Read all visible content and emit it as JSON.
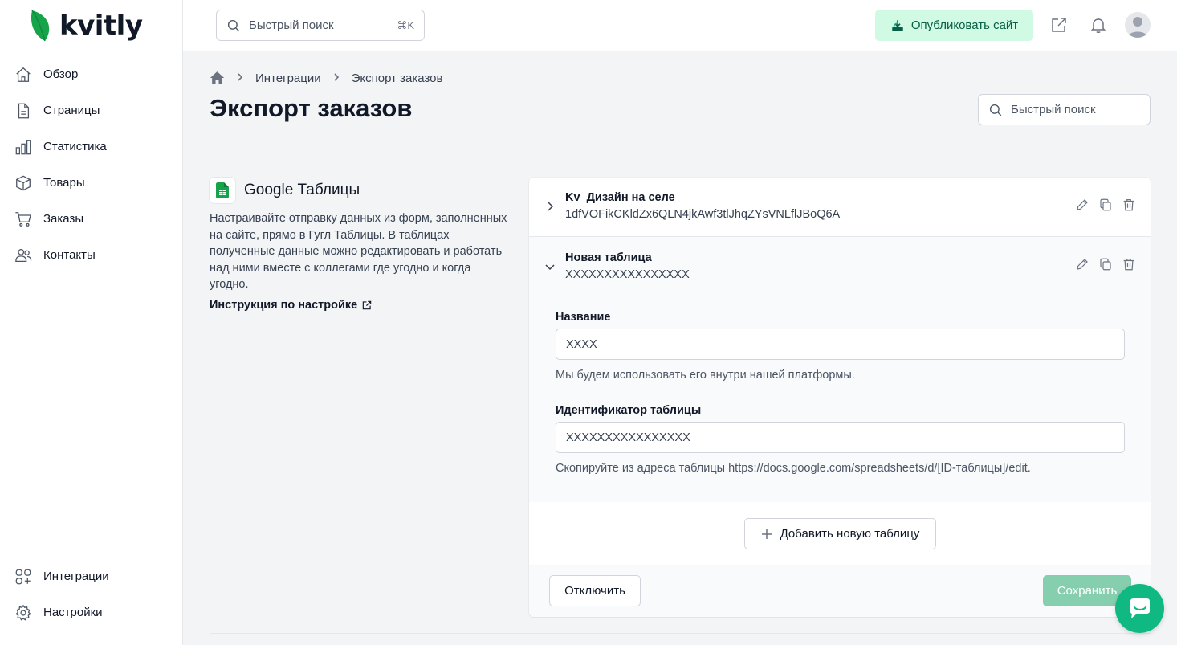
{
  "brand": {
    "name": "kvitly",
    "accent": "#10b981",
    "leaf_color": "#16a34a"
  },
  "sidebar": {
    "items": [
      {
        "label": "Обзор",
        "icon": "home-icon"
      },
      {
        "label": "Страницы",
        "icon": "document-icon"
      },
      {
        "label": "Статистика",
        "icon": "bar-chart-icon"
      },
      {
        "label": "Товары",
        "icon": "box-icon"
      },
      {
        "label": "Заказы",
        "icon": "cart-icon"
      },
      {
        "label": "Контакты",
        "icon": "users-icon"
      }
    ],
    "bottom_items": [
      {
        "label": "Интеграции",
        "icon": "integrations-icon"
      },
      {
        "label": "Настройки",
        "icon": "gear-icon"
      }
    ]
  },
  "topbar": {
    "search_placeholder": "Быстрый поиск",
    "search_shortcut": "⌘K",
    "publish_label": "Опубликовать сайт"
  },
  "breadcrumb": {
    "items": [
      "Интеграции",
      "Экспорт заказов"
    ]
  },
  "page": {
    "title": "Экспорт заказов",
    "search_placeholder": "Быстрый поиск"
  },
  "integration": {
    "title": "Google Таблицы",
    "description": "Настраивайте отправку данных из форм, заполненных на сайте, прямо в Гугл Таблицы. В таблицах полученные данные можно редактировать и работать над ними вместе с коллегами где угодно и когда угодно.",
    "instruction_link": "Инструкция по настройке"
  },
  "tables": [
    {
      "name": "Kv_Дизайн на селе",
      "id": "1dfVOFikCKldZx6QLN4jkAwf3tlJhqZYsVNLflJBoQ6A",
      "expanded": false
    },
    {
      "name": "Новая таблица",
      "id": "XXXXXXXXXXXXXXXX",
      "expanded": true
    }
  ],
  "form": {
    "name_label": "Название",
    "name_value": "XXXX",
    "name_help": "Мы будем использовать его внутри нашей платформы.",
    "id_label": "Идентификатор таблицы",
    "id_value": "XXXXXXXXXXXXXXXX",
    "id_help": "Скопируйте из адреса таблицы https://docs.google.com/spreadsheets/d/[ID-таблицы]/edit."
  },
  "buttons": {
    "add_table": "Добавить новую таблицу",
    "disable": "Отключить",
    "save": "Сохранить"
  }
}
